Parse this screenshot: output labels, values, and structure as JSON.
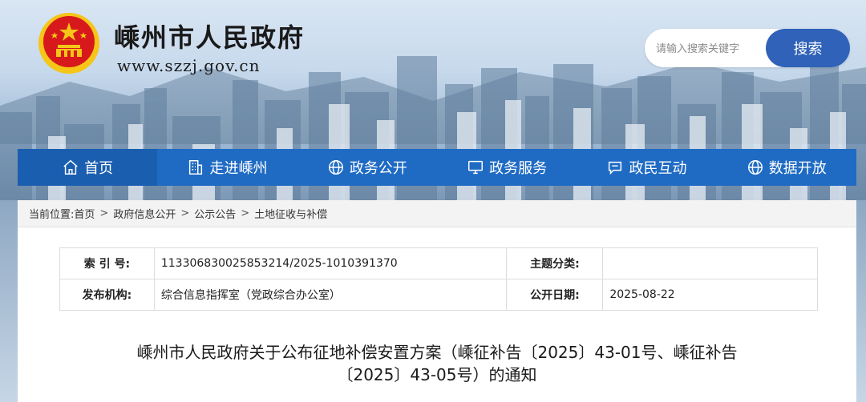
{
  "header": {
    "title": "嵊州市人民政府",
    "url": "www.szzj.gov.cn",
    "emblem_icon": "national-emblem-icon"
  },
  "search": {
    "placeholder": "请输入搜索关键字",
    "value": "",
    "button_label": "搜索"
  },
  "nav": {
    "items": [
      {
        "label": "首页",
        "icon": "home-icon"
      },
      {
        "label": "走进嵊州",
        "icon": "building-icon"
      },
      {
        "label": "政务公开",
        "icon": "globe-icon"
      },
      {
        "label": "政务服务",
        "icon": "monitor-icon"
      },
      {
        "label": "政民互动",
        "icon": "chat-icon"
      },
      {
        "label": "数据开放",
        "icon": "globe-icon"
      }
    ]
  },
  "breadcrumb": {
    "prefix": "当前位置:",
    "items": [
      "首页",
      "政府信息公开",
      "公示公告",
      "土地征收与补偿"
    ],
    "separator": ">"
  },
  "meta": {
    "index_label": "索 引 号:",
    "index_value": "113306830025853214/2025-1010391370",
    "topic_label": "主题分类:",
    "topic_value": "",
    "publisher_label": "发布机构:",
    "publisher_value": "综合信息指挥室（党政综合办公室）",
    "date_label": "公开日期:",
    "date_value": "2025-08-22"
  },
  "document": {
    "title_line1": "嵊州市人民政府关于公布征地补偿安置方案（嵊征补告〔2025〕43-01号、嵊征补告",
    "title_line2": "〔2025〕43-05号）的通知"
  },
  "colors": {
    "nav_bg": "#1f6bc4",
    "search_button": "#2f62b8",
    "emblem_red": "#d7191c",
    "emblem_gold": "#f5c518"
  }
}
